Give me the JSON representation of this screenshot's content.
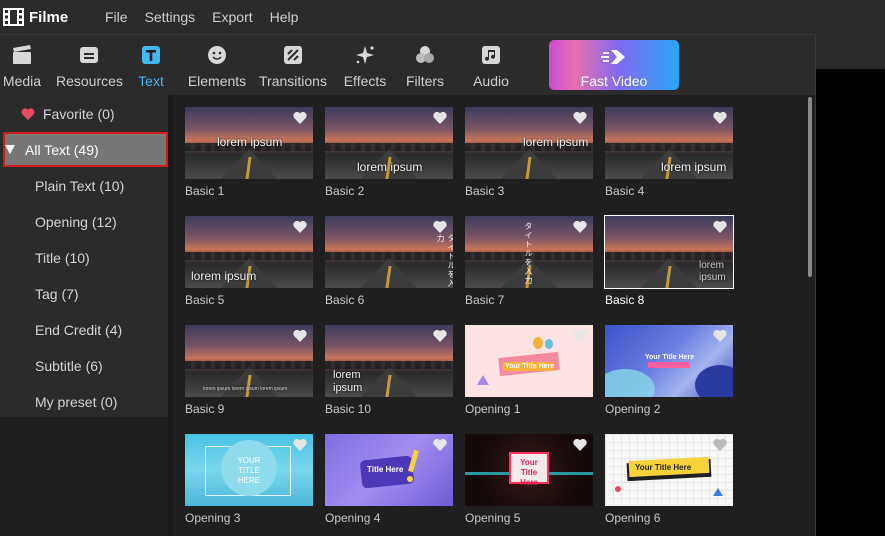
{
  "app": {
    "name": "Filme"
  },
  "menu": [
    "File",
    "Settings",
    "Export",
    "Help"
  ],
  "toolbar": {
    "tabs": [
      {
        "label": "Media",
        "icon": "clapperboard-icon"
      },
      {
        "label": "Resources",
        "icon": "folder-icon"
      },
      {
        "label": "Text",
        "icon": "text-t-icon",
        "active": true
      },
      {
        "label": "Elements",
        "icon": "sticker-face-icon"
      },
      {
        "label": "Transitions",
        "icon": "transition-icon"
      },
      {
        "label": "Effects",
        "icon": "sparkle-icon"
      },
      {
        "label": "Filters",
        "icon": "filter-circles-icon"
      },
      {
        "label": "Audio",
        "icon": "music-note-icon"
      }
    ],
    "fast_video_label": "Fast Video"
  },
  "sidebar": {
    "favorite": "Favorite (0)",
    "all_text": "All Text (49)",
    "items": [
      "Plain Text (10)",
      "Opening (12)",
      "Title (10)",
      "Tag (7)",
      "End Credit (4)",
      "Subtitle (6)",
      "My preset (0)"
    ]
  },
  "cards": [
    {
      "label": "Basic 1",
      "overlay": "lorem ipsum"
    },
    {
      "label": "Basic 2",
      "overlay": "lorem ipsum"
    },
    {
      "label": "Basic 3",
      "overlay": "lorem ipsum"
    },
    {
      "label": "Basic 4",
      "overlay": "lorem ipsum"
    },
    {
      "label": "Basic 5",
      "overlay": "lorem ipsum"
    },
    {
      "label": "Basic 6",
      "overlay": "タイトルを入力"
    },
    {
      "label": "Basic 7",
      "overlay": "タイトルを入力"
    },
    {
      "label": "Basic 8",
      "overlay": "lorem ipsum",
      "selected": true
    },
    {
      "label": "Basic 9",
      "overlay": "lorem ipsum lorem ipsum lorem ipsum"
    },
    {
      "label": "Basic 10",
      "overlay": "lorem ipsum"
    },
    {
      "label": "Opening 1",
      "overlay": "Your Title Here"
    },
    {
      "label": "Opening 2",
      "overlay": "Your Title Here"
    },
    {
      "label": "Opening 3",
      "overlay": "YOUR TITLE HERE"
    },
    {
      "label": "Opening 4",
      "overlay": "Title Here"
    },
    {
      "label": "Opening 5",
      "overlay": "Your Title Here"
    },
    {
      "label": "Opening 6",
      "overlay": "Your Title Here"
    }
  ],
  "colors": {
    "accent": "#3fb8f5",
    "selection_outline": "#d01c1c",
    "favorite_heart": "#e84a5f"
  }
}
